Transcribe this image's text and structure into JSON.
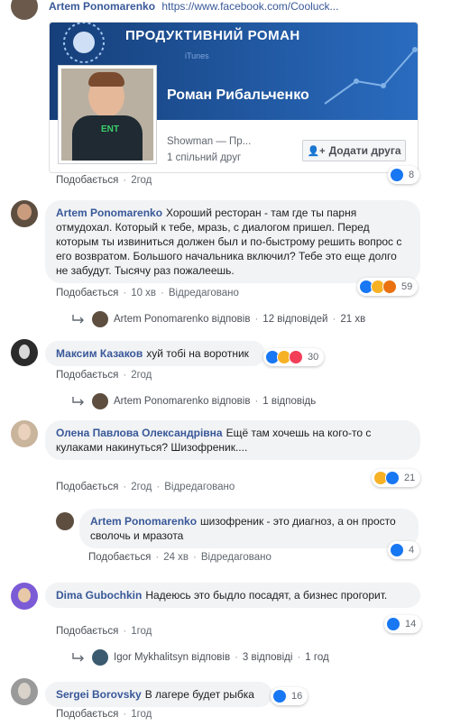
{
  "top": {
    "author": "Artem Ponomarenko",
    "url": "https://www.facebook.com/Cooluck..."
  },
  "preview": {
    "banner_text": "ПРОДУКТИВНИЙ РОМАН",
    "banner_small": "iTunes",
    "shirt_text": "ENT",
    "name": "Роман Рибальченко",
    "subtitle": "Showman — Пр...",
    "mutual": "1 спільний друг",
    "add_friend": "Додати друга"
  },
  "top_meta": {
    "like": "Подобається",
    "time": "2год",
    "count": "8"
  },
  "comments": [
    {
      "author": "Artem Ponomarenko",
      "text": "Хороший ресторан - там где ты парня отмудохал. Который к тебе, мразь, с диалогом пришел. Перед которым ты извиниться должен был и по-быстрому решить вопрос с его возвратом. Большого начальника включил? Тебе это еще долго не забудут. Тысячу раз пожалеешь.",
      "like": "Подобається",
      "time": "10 хв",
      "edited": "Відредаговано",
      "count": "59",
      "replies": {
        "name": "Artem Ponomarenko",
        "verb": "відповів",
        "count": "12 відповідей",
        "time": "21 хв"
      }
    },
    {
      "author": "Максим Казаков",
      "text": "хуй тобі на воротник",
      "like": "Подобається",
      "time": "2год",
      "count": "30",
      "replies": {
        "name": "Artem Ponomarenko",
        "verb": "відповів",
        "count": "1 відповідь"
      }
    },
    {
      "author": "Олена Павлова Олександрівна",
      "text": "Ещё там хочешь на кого-то с кулаками накинуться? Шизофреник....",
      "like": "Подобається",
      "time": "2год",
      "edited": "Відредаговано",
      "count": "21",
      "nested": {
        "author": "Artem Ponomarenko",
        "text": "шизофреник - это диагноз, а он просто сволочь и мразота",
        "like": "Подобається",
        "time": "24 хв",
        "edited": "Відредаговано",
        "count": "4"
      }
    },
    {
      "author": "Dima Gubochkin",
      "text": "Надеюсь это быдло посадят, а бизнес прогорит.",
      "like": "Подобається",
      "time": "1год",
      "count": "14",
      "replies": {
        "name": "Igor Mykhalitsyn",
        "verb": "відповів",
        "count": "3 відповіді",
        "time": "1 год"
      }
    },
    {
      "author": "Sergei Borovsky",
      "text": "В лагере будет рыбка",
      "like": "Подобається",
      "time": "1год",
      "count": "16"
    }
  ],
  "colors": {
    "link": "#385898",
    "bubble": "#f2f3f5",
    "like": "#1877f2"
  }
}
